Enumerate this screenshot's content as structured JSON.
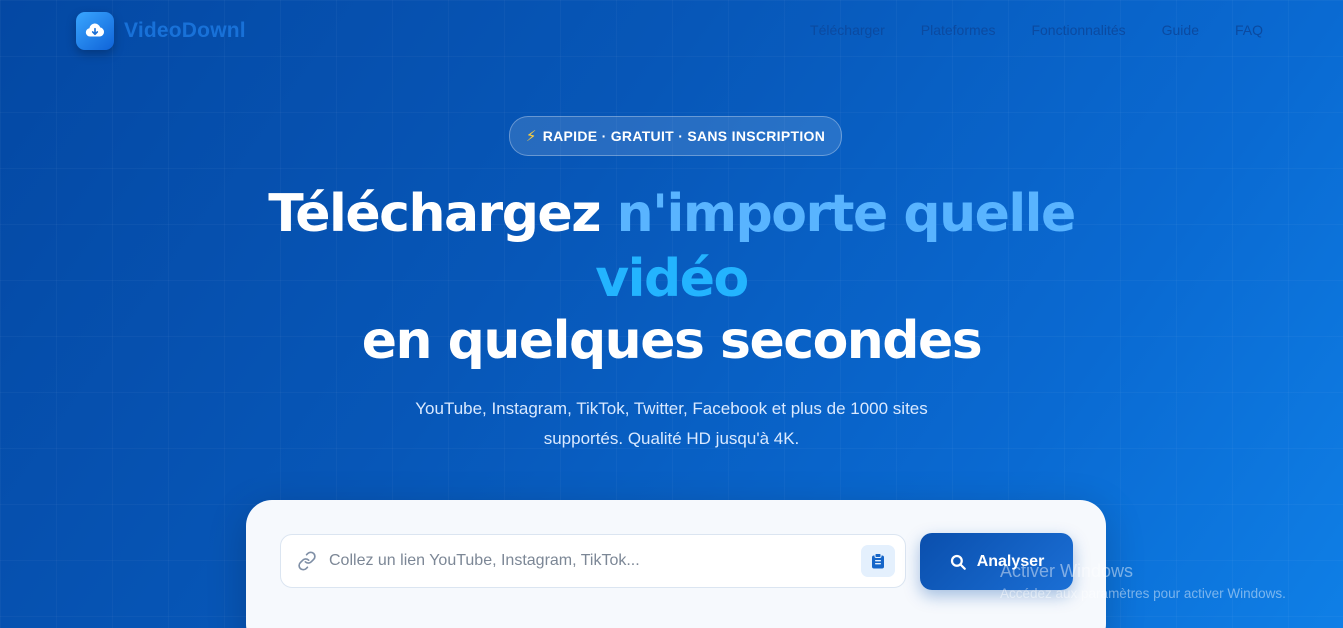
{
  "header": {
    "logo_text": "VideoDownl",
    "nav": [
      "Télécharger",
      "Plateformes",
      "Fonctionnalités",
      "Guide",
      "FAQ"
    ]
  },
  "hero": {
    "badge": "RAPIDE · GRATUIT · SANS INSCRIPTION",
    "headline_part1": "Téléchargez ",
    "headline_part2": "n'importe quelle",
    "headline_part3": "vidéo",
    "headline_part4": "en quelques secondes",
    "subtitle_line1": "YouTube, Instagram, TikTok, Twitter, Facebook et plus de 1000 sites",
    "subtitle_line2": "supportés. Qualité HD jusqu'à 4K."
  },
  "search": {
    "placeholder": "Collez un lien YouTube, Instagram, TikTok...",
    "value": "",
    "button_label": "Analyser"
  },
  "watermark": {
    "title": "Activer Windows",
    "subtitle": "Accédez aux paramètres pour activer Windows."
  },
  "colors": {
    "accent": "#0a4fad",
    "highlight_blue": "#59b4ff",
    "highlight_cyan": "#23b4ff",
    "bolt": "#ffcf3a"
  },
  "icons": {
    "logo": "cloud-download-icon",
    "badge": "lightning-bolt-icon",
    "input": "link-icon",
    "paste": "clipboard-icon",
    "button": "search-icon"
  }
}
